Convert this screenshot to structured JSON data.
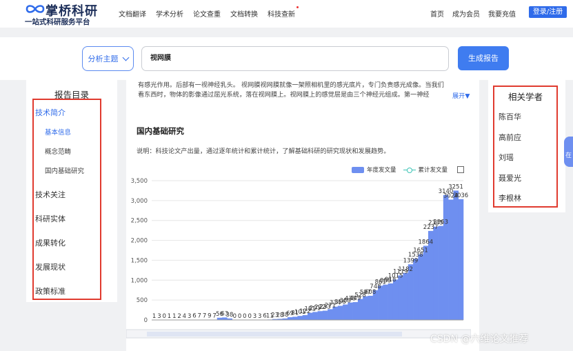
{
  "header": {
    "logo_main": "掌桥科研",
    "logo_sub": "一站式科研服务平台",
    "nav_left": [
      "文档翻译",
      "学术分析",
      "论文查重",
      "文档转换",
      "科技查新"
    ],
    "nav_right": [
      "首页",
      "成为会员",
      "我要充值"
    ],
    "login_label": "登录/注册"
  },
  "search": {
    "topic_label": "分析主题",
    "query": "视网膜",
    "report_button": "生成报告"
  },
  "toc": {
    "title": "报告目录",
    "items": [
      {
        "label": "技术简介",
        "children": [
          "基本信息",
          "概念范畴",
          "国内基础研究"
        ]
      },
      {
        "label": "技术关注"
      },
      {
        "label": "科研实体"
      },
      {
        "label": "成果转化"
      },
      {
        "label": "发展现状"
      },
      {
        "label": "政策标准"
      }
    ]
  },
  "intro": {
    "line1": "有感光作用。后部有一视神经乳头。  视网膜视网膜就像一架照相机里的感光底片，专门负责感光成像。当我们",
    "line2": "看东西时，物体的影像通过屈光系统，落在视网膜上。视网膜上的感觉层是由三个神经元组成。第一神经",
    "expand": "展开▼"
  },
  "section": {
    "title": "国内基础研究",
    "description": "说明：科技论文产出量，通过逐年统计和累计统计，了解基础科研的研究现状和发展趋势。"
  },
  "scholars": {
    "title": "相关学者",
    "names": [
      "陈百华",
      "高前应",
      "刘瑶",
      "聂爱光",
      "李根林"
    ]
  },
  "side_tab_label": "在",
  "watermark": "CSDN @六维论文推荐",
  "chart_data": {
    "type": "bar",
    "legend": [
      "年度发文量",
      "累计发文量"
    ],
    "bar_color": "#6e8ff0",
    "line_color": "#3cc3b5",
    "ylim": [
      0,
      3500
    ],
    "yticks": [
      0,
      500,
      1000,
      1500,
      2000,
      2500,
      3000,
      3500
    ],
    "series": [
      {
        "name": "年度发文量",
        "values": [
          1,
          3,
          0,
          1,
          1,
          2,
          4,
          3,
          6,
          7,
          7,
          9,
          7,
          56,
          63,
          38,
          0,
          0,
          0,
          0,
          3,
          3,
          6,
          11,
          23,
          28,
          38,
          69,
          81,
          101,
          122,
          181,
          201,
          222,
          233,
          271,
          334,
          356,
          388,
          438,
          449,
          528,
          597,
          608,
          748,
          861,
          888,
          918,
          1015,
          1119,
          1182,
          1399,
          1538,
          1651,
          1864,
          2237,
          2345,
          2363,
          3140,
          3024,
          3251,
          3036
        ],
        "labels_shown": [
          "1",
          "3",
          "0",
          "1",
          "1",
          "2",
          "4",
          "3",
          "6",
          "7",
          "7",
          "9",
          "7",
          "56",
          "63",
          "38",
          "0",
          "0",
          "0",
          "0",
          "3",
          "3",
          "6",
          "11",
          "23",
          "28",
          "38",
          "69",
          "81",
          "101",
          "122",
          "181",
          "201",
          "222",
          "233",
          "271",
          "334",
          "356",
          "388",
          "438",
          "449",
          "528",
          "597",
          "608",
          "748",
          "861",
          "888",
          "918",
          "1015",
          "1119",
          "1182",
          "1399",
          "1538",
          "1651",
          "1864",
          "2237",
          "2345",
          "2363",
          "3140",
          "3024",
          "3251",
          "3036"
        ]
      }
    ]
  }
}
